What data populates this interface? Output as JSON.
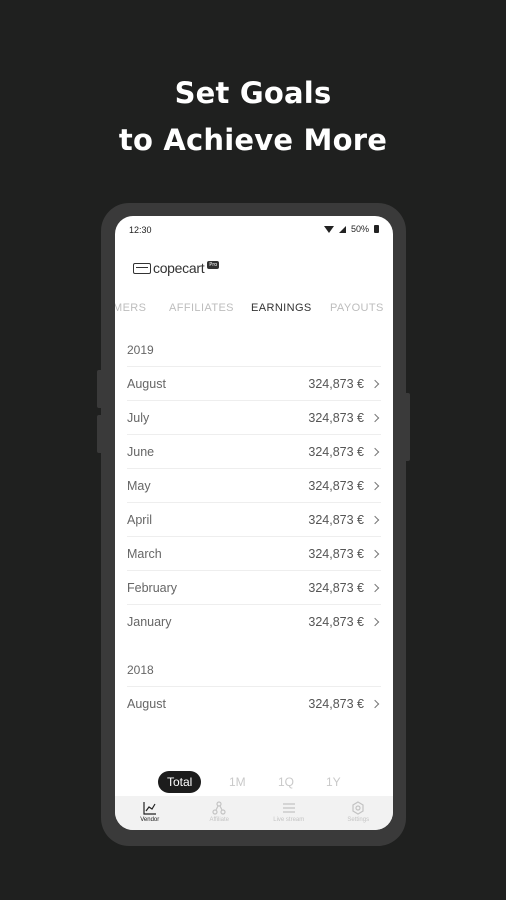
{
  "headline": {
    "line1": "Set Goals",
    "line2": "to Achieve More"
  },
  "statusbar": {
    "time": "12:30",
    "battery": "50%"
  },
  "app": {
    "logo_text": "copecart",
    "logo_badge": "Pro"
  },
  "tabs": [
    {
      "label": "MERS",
      "active": false
    },
    {
      "label": "AFFILIATES",
      "active": false
    },
    {
      "label": "EARNINGS",
      "active": true
    },
    {
      "label": "PAYOUTS",
      "active": false
    }
  ],
  "earnings": [
    {
      "year": "2019",
      "months": [
        {
          "month": "August",
          "amount": "324,873 €"
        },
        {
          "month": "July",
          "amount": "324,873 €"
        },
        {
          "month": "June",
          "amount": "324,873 €"
        },
        {
          "month": "May",
          "amount": "324,873 €"
        },
        {
          "month": "April",
          "amount": "324,873 €"
        },
        {
          "month": "March",
          "amount": "324,873 €"
        },
        {
          "month": "February",
          "amount": "324,873 €"
        },
        {
          "month": "January",
          "amount": "324,873 €"
        }
      ]
    },
    {
      "year": "2018",
      "months": [
        {
          "month": "August",
          "amount": "324,873 €"
        }
      ]
    }
  ],
  "periods": [
    {
      "label": "Total",
      "active": true
    },
    {
      "label": "1M",
      "active": false
    },
    {
      "label": "1Q",
      "active": false
    },
    {
      "label": "1Y",
      "active": false
    }
  ],
  "bottom_nav": [
    {
      "label": "Vendor",
      "icon": "chart-icon",
      "active": true
    },
    {
      "label": "Affiliate",
      "icon": "network-icon",
      "active": false
    },
    {
      "label": "Live stream",
      "icon": "list-icon",
      "active": false
    },
    {
      "label": "Settings",
      "icon": "gear-icon",
      "active": false
    }
  ],
  "colors": {
    "background": "#1f201f",
    "phone_frame": "#3a3a3a",
    "screen": "#ffffff",
    "accent": "#1c1c1c"
  }
}
